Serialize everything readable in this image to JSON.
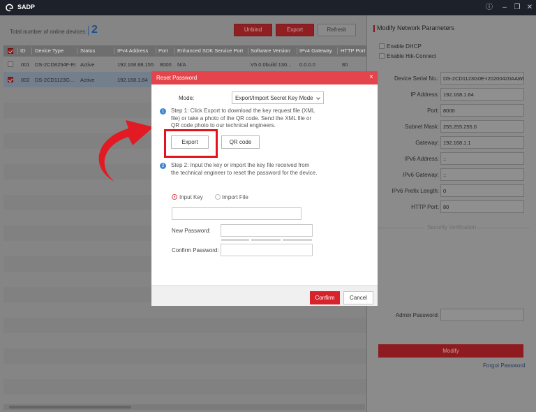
{
  "app": {
    "title": "SADP"
  },
  "window_controls": {
    "info": "ⓘ",
    "minimize": "–",
    "restore": "❐",
    "close": "✕"
  },
  "summary": {
    "online_label": "Total number of online devices:",
    "online_count": "2"
  },
  "toolbar": {
    "unbind": "Unbind",
    "export": "Export",
    "refresh": "Refresh"
  },
  "table": {
    "headers": [
      "ID",
      "Device Type",
      "Status",
      "IPv4 Address",
      "Port",
      "Enhanced SDK Service Port",
      "Software Version",
      "IPv4 Gateway",
      "HTTP Port"
    ],
    "rows": [
      {
        "checked": false,
        "id": "001",
        "device_type": "DS-2CD8254F-EI",
        "status": "Active",
        "ipv4": "192.168.88.155",
        "port": "8000",
        "sdk_port": "N/A",
        "version": "V5.0.0build 130...",
        "gateway": "0.0.0.0",
        "http_port": "80"
      },
      {
        "checked": true,
        "id": "002",
        "device_type": "DS-2CD1123G...",
        "status": "Active",
        "ipv4": "192.168.1.64",
        "port": "",
        "sdk_port": "",
        "version": "",
        "gateway": "",
        "http_port": ""
      }
    ]
  },
  "right_panel": {
    "title": "Modify Network Parameters",
    "enable_dhcp": "Enable DHCP",
    "enable_hik_connect": "Enable Hik-Connect",
    "fields": [
      {
        "label": "Device Serial No.:",
        "value": "DS-2CD1123G0E-I20200420AAWR"
      },
      {
        "label": "IP Address:",
        "value": "192.168.1.64"
      },
      {
        "label": "Port:",
        "value": "8000"
      },
      {
        "label": "Subnet Mask:",
        "value": "255.255.255.0"
      },
      {
        "label": "Gateway:",
        "value": "192.168.1.1"
      },
      {
        "label": "IPv6 Address:",
        "value": "::"
      },
      {
        "label": "IPv6 Gateway:",
        "value": "::"
      },
      {
        "label": "IPv6 Prefix Length:",
        "value": "0"
      },
      {
        "label": "HTTP Port:",
        "value": "80"
      }
    ],
    "security_verification": "Security Verification",
    "admin_password_label": "Admin Password:",
    "modify": "Modify",
    "forgot_password": "Forgot Password"
  },
  "dialog": {
    "title": "Reset Password",
    "close": "×",
    "mode_label": "Mode:",
    "mode_value": "Export/Import Secret Key Mode",
    "step1_num": "1",
    "step1_text": "Step 1: Click Export to download the key request file (XML file) or take a photo of the QR code. Send the XML file or QR code photo to our technical engineers.",
    "export": "Export",
    "qr_code": "QR code",
    "step2_num": "2",
    "step2_text": "Step 2: Input the key or import the key file received from the technical engineer to reset the password for the device.",
    "input_key": "Input Key",
    "import_file": "Import File",
    "new_password": "New Password:",
    "confirm_password": "Confirm Password:",
    "confirm": "Confirm",
    "cancel": "Cancel"
  },
  "colors": {
    "accent_red": "#e4444b",
    "titlebar": "#1d222a",
    "step_blue": "#3b85d4",
    "highlight_red": "#e1141b"
  }
}
